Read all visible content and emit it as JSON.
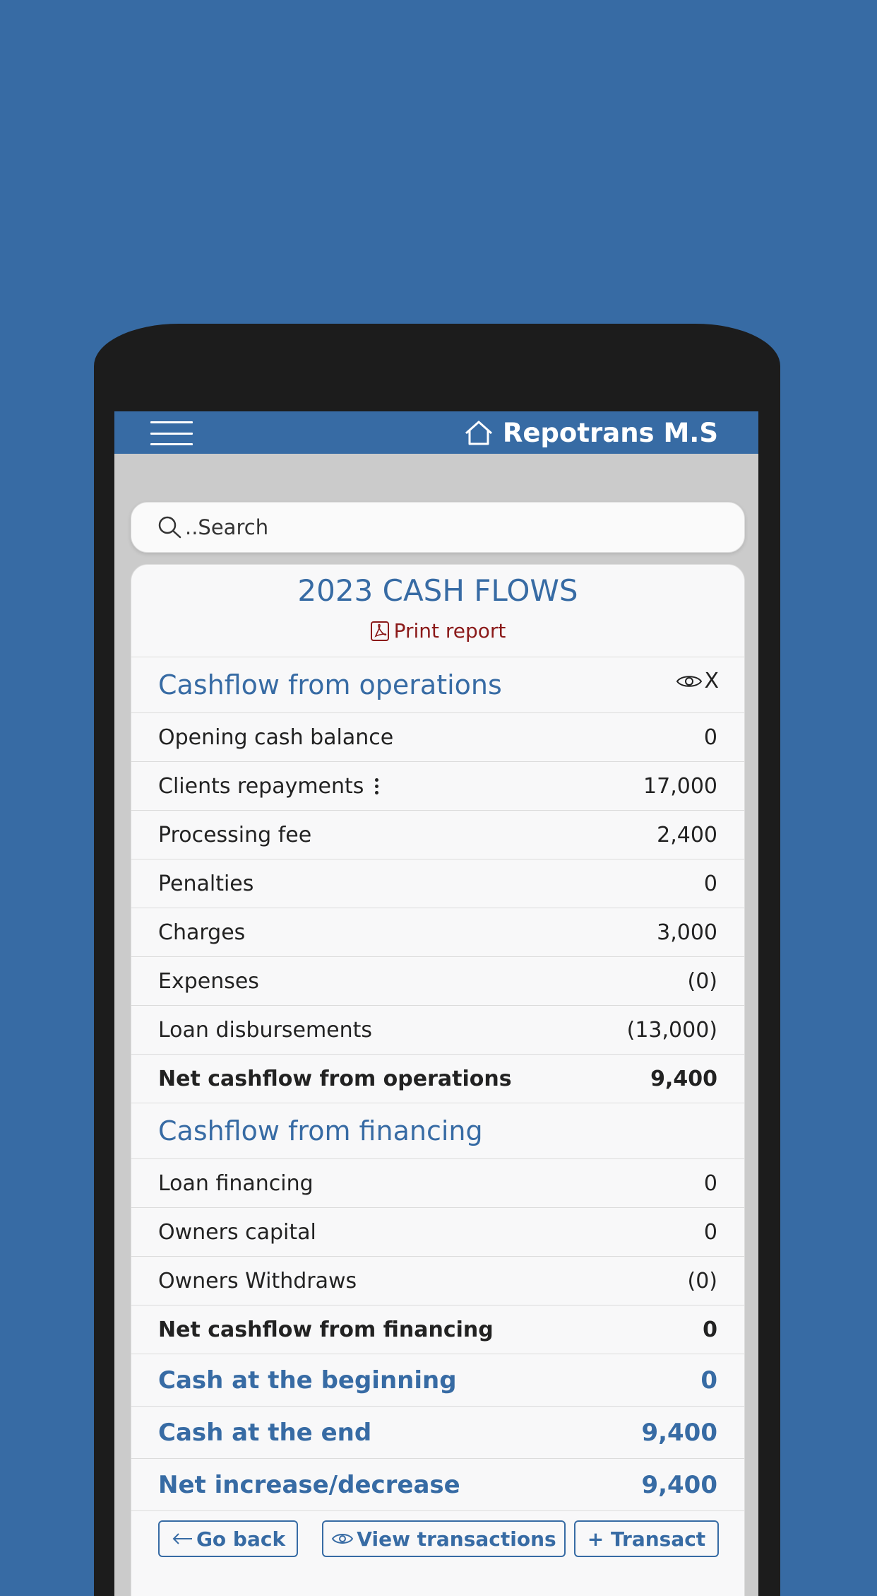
{
  "header": {
    "brand": "Repotrans M.S"
  },
  "search": {
    "placeholder": "..Search"
  },
  "report": {
    "title": "2023 CASH FLOWS",
    "print_label": "Print report"
  },
  "operations": {
    "heading": "Cashflow from operations",
    "toggle_label": "X",
    "rows": [
      {
        "label": "Opening cash balance",
        "value": "0"
      },
      {
        "label": "Clients repayments",
        "value": "17,000"
      },
      {
        "label": "Processing fee",
        "value": "2,400"
      },
      {
        "label": "Penalties",
        "value": "0"
      },
      {
        "label": "Charges",
        "value": "3,000"
      },
      {
        "label": "Expenses",
        "value": "(0)"
      },
      {
        "label": "Loan disbursements",
        "value": "(13,000)"
      }
    ],
    "total": {
      "label": "Net cashflow from operations",
      "value": "9,400"
    }
  },
  "financing": {
    "heading": "Cashflow from financing",
    "rows": [
      {
        "label": "Loan financing",
        "value": "0"
      },
      {
        "label": "Owners capital",
        "value": "0"
      },
      {
        "label": "Owners Withdraws",
        "value": "(0)"
      }
    ],
    "total": {
      "label": "Net cashflow from financing",
      "value": "0"
    }
  },
  "summary": [
    {
      "label": "Cash at the beginning",
      "value": "0"
    },
    {
      "label": "Cash at the end",
      "value": "9,400"
    },
    {
      "label": "Net increase/decrease",
      "value": "9,400"
    }
  ],
  "actions": {
    "go_back": "Go back",
    "view_transactions": "View transactions",
    "transact": "+ Transact"
  },
  "colors": {
    "background": "#376ba4",
    "accent": "#376ba4",
    "print": "#8b1a1a",
    "phone_frame": "#1c1c1c"
  }
}
